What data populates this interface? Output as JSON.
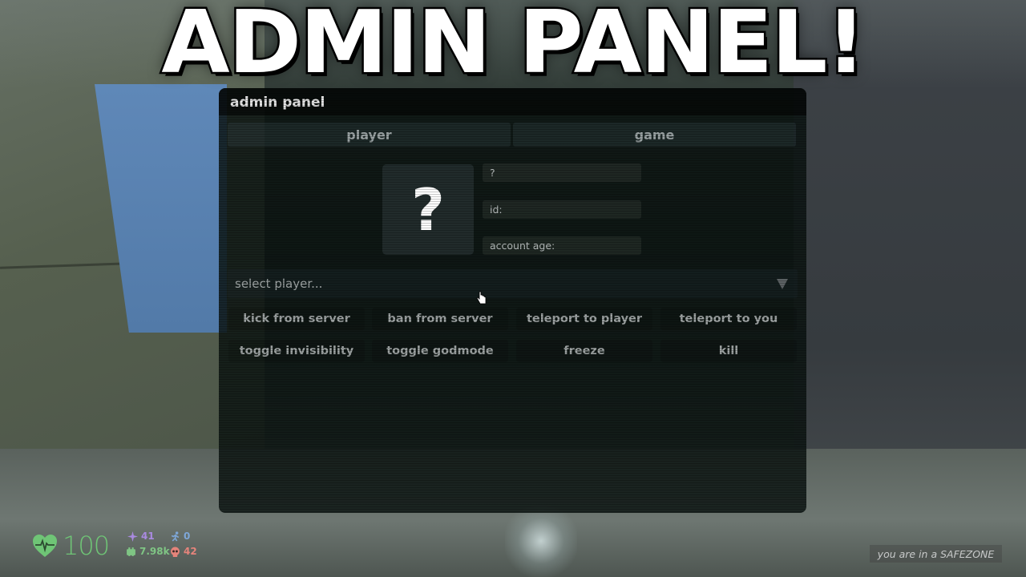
{
  "thumbnail": {
    "headline": "ADMIN PANEL!"
  },
  "admin_panel": {
    "title": "admin panel",
    "tabs": [
      {
        "label": "player",
        "active": true
      },
      {
        "label": "game",
        "active": false
      }
    ],
    "player_info": {
      "avatar_placeholder": "?",
      "name": "?",
      "id_label": "id:",
      "account_age_label": "account age:"
    },
    "player_select": {
      "placeholder": "select player...",
      "arrow_icon": "triangle-down"
    },
    "actions": [
      {
        "label": "kick from server"
      },
      {
        "label": "ban from server"
      },
      {
        "label": "teleport to player"
      },
      {
        "label": "teleport to you"
      },
      {
        "label": "toggle invisibility"
      },
      {
        "label": "toggle godmode"
      },
      {
        "label": "freeze"
      },
      {
        "label": "kill"
      }
    ]
  },
  "hud": {
    "health": {
      "value": "100",
      "icon": "heart-pulse",
      "color": "#6fc576"
    },
    "stats": [
      {
        "icon": "sparkle",
        "value": "41",
        "color": "#a98ae0"
      },
      {
        "icon": "running-person",
        "value": "0",
        "color": "#7ea7d8"
      },
      {
        "icon": "money",
        "value": "7.98k",
        "color": "#7fc584"
      },
      {
        "icon": "skull",
        "value": "42",
        "color": "#e5847b"
      }
    ],
    "zone_status": "you are in a SAFEZONE"
  }
}
